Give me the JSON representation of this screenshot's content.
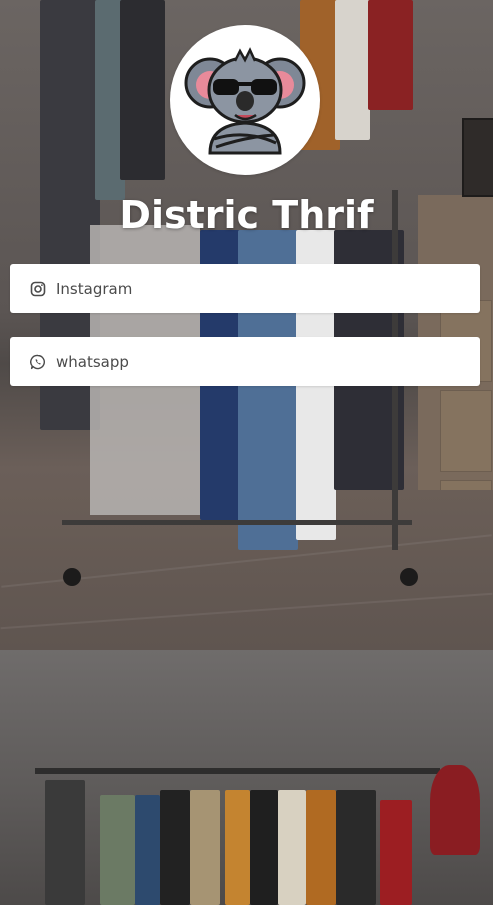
{
  "profile": {
    "title": "Distric Thrif",
    "avatar_icon": "koala-sunglasses-icon"
  },
  "links": {
    "instagram": {
      "label": "Instagram",
      "icon": "instagram-icon"
    },
    "whatsapp": {
      "label": "whatsapp",
      "icon": "whatsapp-icon"
    }
  },
  "colors": {
    "button_bg": "#ffffff",
    "button_text": "#4b4b4b",
    "title_text": "#ffffff"
  }
}
